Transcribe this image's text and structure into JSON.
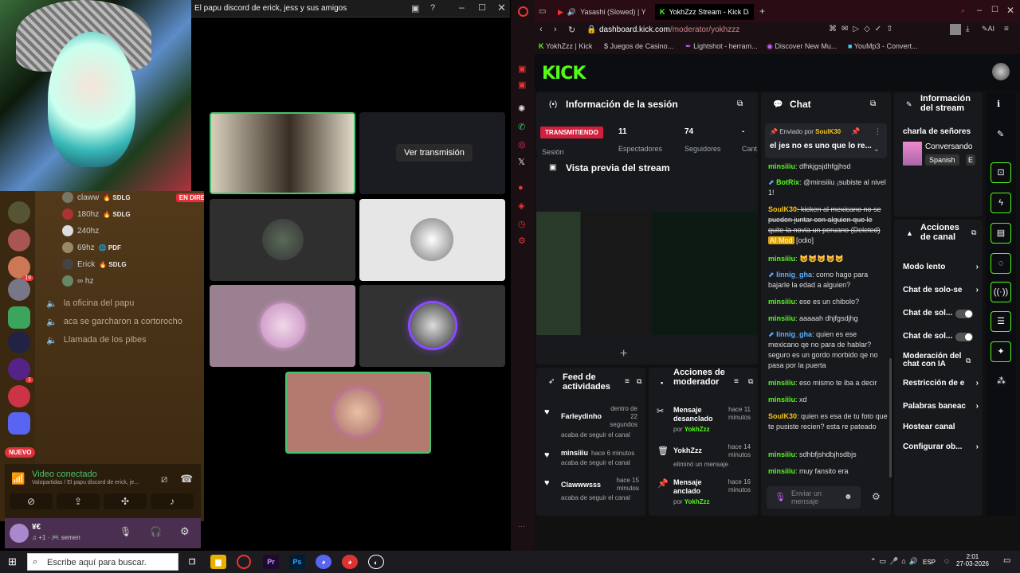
{
  "discord": {
    "servers": [
      {
        "badge": ""
      },
      {
        "badge": ""
      },
      {
        "badge": "19"
      },
      {
        "badge": ""
      },
      {
        "badge": ""
      },
      {
        "badge": ""
      },
      {
        "badge": "1"
      },
      {
        "badge": ""
      },
      {
        "badge": ""
      }
    ],
    "nuevo": "NUEVO",
    "voice_users": [
      {
        "name": "claww",
        "tag": "🔥 SDLG",
        "live": "EN DIRECTO"
      },
      {
        "name": "180hz",
        "tag": "🔥 SDLG",
        "live": ""
      },
      {
        "name": "240hz",
        "tag": "",
        "live": ""
      },
      {
        "name": "69hz",
        "tag": "🌐 PDF",
        "live": ""
      },
      {
        "name": "Erick",
        "tag": "🔥 SDLG",
        "live": ""
      },
      {
        "name": "∞ hz",
        "tag": "",
        "live": ""
      }
    ],
    "channels": [
      "la oficina del papu",
      "aca se garcharon a cortorocho",
      "Llamada de los pibes"
    ],
    "voice": {
      "status": "Video conectado",
      "sub": "Valopartidas / El papu discord de erick, je..."
    },
    "user": {
      "name": "¥€",
      "sub": "♫ +1 · 🎮 semen"
    },
    "stream_window": {
      "title": "El papu discord de erick, jess y sus amigos",
      "ver": "Ver transmisión"
    }
  },
  "browser": {
    "tabs": [
      {
        "label": "Yasashi (Slowed) | You"
      },
      {
        "label": "YokhZzz Stream - Kick Da"
      }
    ],
    "url_host": "dashboard.kick.com",
    "url_path": "/moderator/yokhzzz",
    "bookmarks": [
      "YokhZzz | Kick",
      "Juegos de Casino...",
      "Lightshot - herram...",
      "Discover New Mu...",
      "YouMp3 - Convert..."
    ]
  },
  "kick": {
    "logo": "KICK",
    "session": {
      "title": "Información de la sesión",
      "status": "TRANSMITIENDO",
      "session_label": "Sesión",
      "viewers": "11",
      "viewers_label": "Espectadores",
      "followers": "74",
      "followers_label": "Seguidores",
      "cant_value": "-",
      "cant_label": "Cant"
    },
    "preview": {
      "title": "Vista previa del stream"
    },
    "chat": {
      "title": "Chat",
      "pinned_by": "Enviado por",
      "pinned_user": "SoulK30",
      "pinned_msg": "el jes no es uno que lo re...",
      "input": "Enviar un mensaje",
      "messages": [
        {
          "user": "minsiiiu",
          "text": ": dfhkjgsjdhfgjhsd"
        },
        {
          "user": "BotRix",
          "text": ": @minsiiiu ¡subiste al nivel 1!"
        },
        {
          "user": "SoulK30",
          "text": ": kicken al mexicano no se pueden juntar con alguien que le quite la novia un peruano (Deleted)",
          "badge": "AI Mod",
          "tail": "[odio]"
        },
        {
          "user": "minsiiiu",
          "text": ": 😺😺😺😺😺"
        },
        {
          "user": "linnig_gha",
          "text": ": como hago para bajarle la edad a alguien?"
        },
        {
          "user": "minsiiiu",
          "text": ": ese es un chibolo?"
        },
        {
          "user": "minsiiiu",
          "text": ": aaaaah dhjfgsdjhg"
        },
        {
          "user": "linnig_gha",
          "text": ": quien es ese mexicano qe no para de hablar? seguro es un gordo morbido qe no pasa por la puerta"
        },
        {
          "user": "minsiiiu",
          "text": ": eso mismo te iba a decir"
        },
        {
          "user": "minsiiiu",
          "text": ": xd"
        },
        {
          "user": "SoulK30",
          "text": ": quien es esa de tu foto que te pusiste recien? esta re pateado"
        },
        {
          "user": "minsiiiu",
          "text": ": sdhbfjshdbjhsdbjs"
        },
        {
          "user": "minsiiiu",
          "text": ": muy fansito era"
        }
      ]
    },
    "stream_info": {
      "title": "Información del stream",
      "stream_title": "charla de señores",
      "category": "Conversando",
      "lang": "Spanish",
      "lang2": "E"
    },
    "channel_actions": {
      "title": "Acciones de canal",
      "items": [
        "Modo lento",
        "Chat de solo-se",
        "Chat de sol...",
        "Chat de sol...",
        "Moderación del chat con IA",
        "Restricción de e",
        "Palabras baneac",
        "Hostear canal",
        "Configurar ob..."
      ]
    },
    "feed": {
      "title": "Feed de actividades",
      "items": [
        {
          "user": "Farleydinho",
          "time": "dentro de 22 segundos",
          "action": "acaba de seguir el canal"
        },
        {
          "user": "minsiiiu",
          "time": "hace 6 minutos",
          "action": "acaba de seguir el canal"
        },
        {
          "user": "Clawwwsss",
          "time": "hace 15 minutos",
          "action": "acaba de seguir el canal"
        }
      ]
    },
    "mod_actions": {
      "title": "Acciones de moderador",
      "items": [
        {
          "title": "Mensaje desanclado",
          "by": "por",
          "user": "YokhZzz",
          "time": "hace 11 minutos"
        },
        {
          "title": "YokhZzz",
          "by": "",
          "user": "eliminó un mensaje",
          "time": "hace 14 minutos"
        },
        {
          "title": "Mensaje anclado",
          "by": "por",
          "user": "YokhZzz",
          "time": "hace 16 minutos"
        }
      ]
    }
  },
  "taskbar": {
    "search": "Escribe aquí para buscar.",
    "lang": "ESP",
    "time": "2:01",
    "date": "27-03-2026"
  }
}
